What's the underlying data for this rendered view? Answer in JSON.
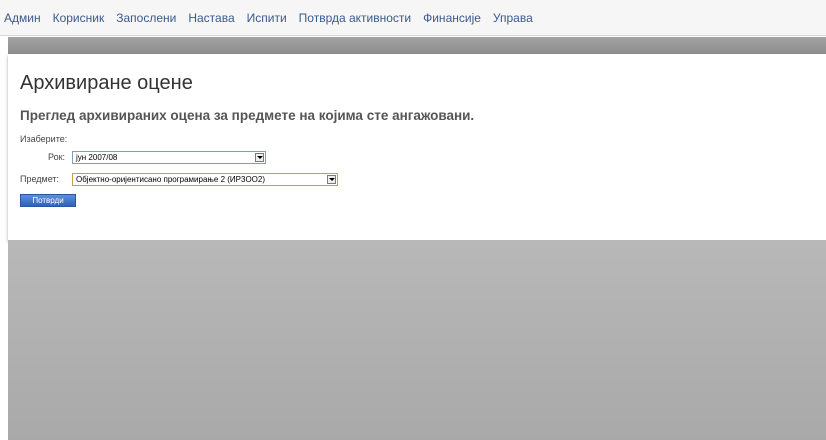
{
  "nav": {
    "items": [
      "Админ",
      "Корисник",
      "Запослени",
      "Настава",
      "Испити",
      "Потврда активности",
      "Финансије",
      "Управа"
    ]
  },
  "page": {
    "title": "Архивиране оцене",
    "subtitle": "Преглед архивираних оцена за предмете на којима сте ангажовани.",
    "choose_label": "Изаберите:"
  },
  "form": {
    "term_label": "Рок:",
    "term_value": "јун 2007/08",
    "subject_label": "Предмет:",
    "subject_value": "Објектно-оријентисано програмирање 2 (ИР3ОО2)",
    "submit_label": "Потврди"
  },
  "colors": {
    "nav_link": "#3a5a8c",
    "button": "#2f62b8",
    "band": "#9a9a9a"
  }
}
